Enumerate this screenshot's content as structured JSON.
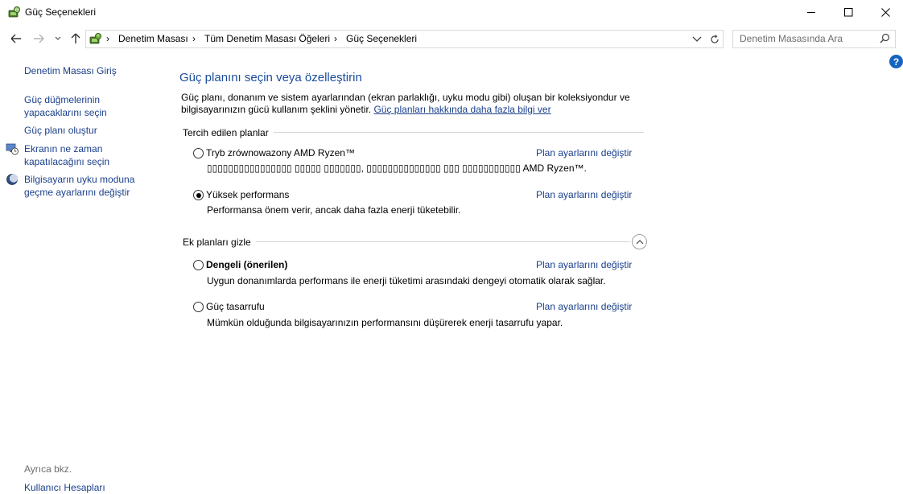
{
  "window": {
    "title": "Güç Seçenekleri"
  },
  "address_bar": {
    "crumbs": [
      "Denetim Masası",
      "Tüm Denetim Masası Öğeleri",
      "Güç Seçenekleri"
    ],
    "separator": "›"
  },
  "search": {
    "placeholder": "Denetim Masasında Ara"
  },
  "help": {
    "label": "?"
  },
  "sidebar": {
    "home": "Denetim Masası Giriş",
    "power_buttons_1": "Güç düğmelerinin",
    "power_buttons_2": "yapacaklarını seçin",
    "create_plan": "Güç planı oluştur",
    "display_off_1": "Ekranın ne zaman",
    "display_off_2": "kapatılacağını seçin",
    "sleep_1": "Bilgisayarın uyku moduna",
    "sleep_2": "geçme ayarlarını değiştir",
    "see_also": "Ayrıca bkz.",
    "user_accounts": "Kullanıcı Hesapları"
  },
  "main": {
    "title": "Güç planını seçin veya özelleştirin",
    "intro": "Güç planı, donanım ve sistem ayarlarından (ekran parlaklığı, uyku modu gibi) oluşan bir koleksiyondur ve bilgisayarınızın gücü kullanım şeklini yönetir.",
    "intro_link": "Güç planları hakkında daha fazla bilgi ver",
    "preferred_label": "Tercih edilen planlar",
    "extra_label": "Ek planları gizle",
    "change_link": "Plan ayarlarını değiştir",
    "plans": [
      {
        "name": "Tryb zrównowazony AMD Ryzen™",
        "desc": "▯▯▯▯▯▯▯▯▯▯▯▯▯▯▯▯ ▯▯▯▯▯ ▯▯▯▯▯▯▯, ▯▯▯▯▯▯▯▯▯▯▯▯▯▯ ▯▯▯ ▯▯▯▯▯▯▯▯▯▯▯ AMD Ryzen™.",
        "selected": false
      },
      {
        "name": "Yüksek performans",
        "desc": "Performansa önem verir, ancak daha fazla enerji tüketebilir.",
        "selected": true
      },
      {
        "name": "Dengeli (önerilen)",
        "desc": "Uygun donanımlarda performans ile enerji tüketimi arasındaki dengeyi otomatik olarak sağlar.",
        "selected": false
      },
      {
        "name": "Güç tasarrufu",
        "desc": "Mümkün olduğunda bilgisayarınızın performansını düşürerek enerji tasarrufu yapar.",
        "selected": false
      }
    ]
  },
  "colors": {
    "link": "#1a3f8b",
    "title_blue": "#1a4c9c",
    "help_blue": "#1565c0"
  }
}
